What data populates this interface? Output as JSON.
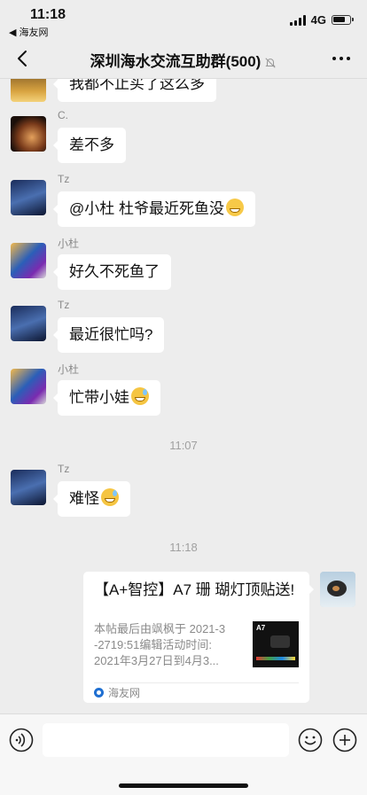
{
  "status": {
    "time": "11:18",
    "back_app": "◀ 海友网",
    "network": "4G"
  },
  "header": {
    "title": "深圳海水交流互助群(500)"
  },
  "messages": [
    {
      "nick": "",
      "text": "我都不止买了这么多"
    },
    {
      "nick": "C.",
      "text": "差不多"
    },
    {
      "nick": "Tz",
      "text": "@小杜 杜爷最近死鱼没"
    },
    {
      "nick": "小杜",
      "text": "好久不死鱼了"
    },
    {
      "nick": "Tz",
      "text": "最近很忙吗?"
    },
    {
      "nick": "小杜",
      "text": "忙带小娃"
    },
    {
      "nick": "Tz",
      "text": "难怪"
    }
  ],
  "timestamps": [
    "11:07",
    "11:18"
  ],
  "link_card": {
    "title": "【A+智控】A7 珊 瑚灯顶贴送!",
    "description": "本帖最后由飒枫于 2021-3\n-2719:51编辑活动时间:\n2021年3月27日到4月3...",
    "thumb_label": "A7",
    "source": "海友网"
  },
  "colors": {
    "background": "#ededed",
    "bubble": "#ffffff",
    "timestamp": "#a0a0a0"
  }
}
